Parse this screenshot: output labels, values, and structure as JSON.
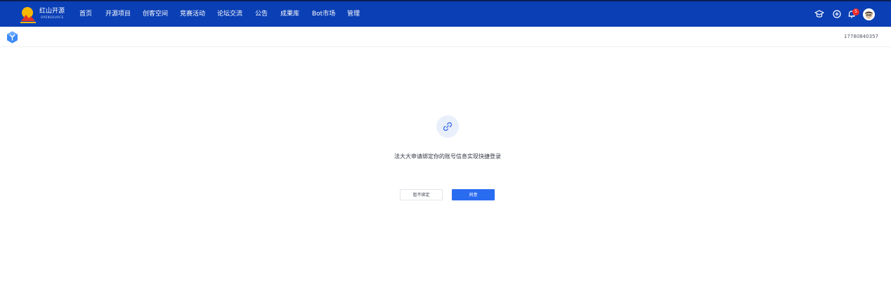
{
  "header": {
    "logo_text": "红山开源",
    "logo_sub": "OPENSOURCE",
    "nav": [
      {
        "label": "首页"
      },
      {
        "label": "开源项目"
      },
      {
        "label": "创客空间"
      },
      {
        "label": "竞赛活动"
      },
      {
        "label": "论坛交流"
      },
      {
        "label": "公告"
      },
      {
        "label": "成果库"
      },
      {
        "label": "Bot市场"
      },
      {
        "label": "管理"
      }
    ],
    "icons": [
      "graduation-cap-icon",
      "plus-circle-icon",
      "bell-icon"
    ],
    "notification_count": "5",
    "brand_color": "#0a3fb5"
  },
  "subheader": {
    "account_id": "17780840357"
  },
  "main": {
    "icon": "link-icon",
    "message": "法大大申请绑定你的账号信息实现快捷登录",
    "secondary_button": "暂不绑定",
    "primary_button": "同意",
    "primary_color": "#2a6cf0"
  }
}
